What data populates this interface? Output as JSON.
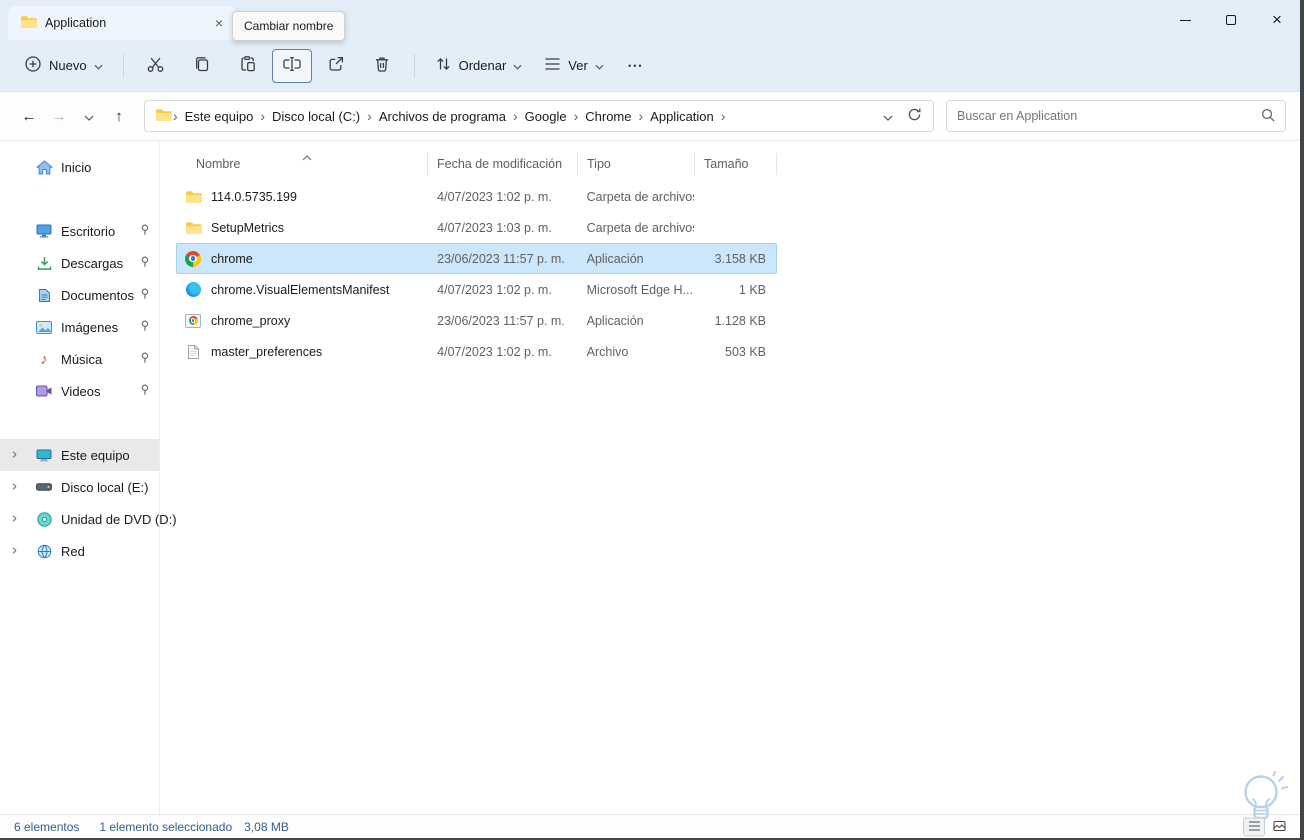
{
  "window": {
    "tab_title": "Application",
    "tooltip": "Cambiar nombre"
  },
  "icons": {
    "back": "←",
    "forward": "→",
    "up": "↑",
    "tab_close": "×",
    "window_close": "×",
    "more": "•••",
    "breadcrumb_separator": "›",
    "tree_chevron": "›",
    "music_note": "♪"
  },
  "toolbar": {
    "new_label": "Nuevo",
    "sort_label": "Ordenar",
    "view_label": "Ver"
  },
  "nav": {
    "search_placeholder": "Buscar en Application",
    "breadcrumbs": [
      "Este equipo",
      "Disco local (C:)",
      "Archivos de programa",
      "Google",
      "Chrome",
      "Application"
    ]
  },
  "sidebar": {
    "home": "Inicio",
    "pinned": [
      {
        "label": "Escritorio"
      },
      {
        "label": "Descargas"
      },
      {
        "label": "Documentos"
      },
      {
        "label": "Imágenes"
      },
      {
        "label": "Música"
      },
      {
        "label": "Videos"
      }
    ],
    "tree": [
      {
        "label": "Este equipo",
        "selected": true
      },
      {
        "label": "Disco local (E:)",
        "selected": false
      },
      {
        "label": "Unidad de DVD (D:)",
        "selected": false
      },
      {
        "label": "Red",
        "selected": false
      }
    ]
  },
  "file_list": {
    "columns": {
      "name": "Nombre",
      "date": "Fecha de modificación",
      "type": "Tipo",
      "size": "Tamaño"
    },
    "rows": [
      {
        "name": "114.0.5735.199",
        "date": "4/07/2023 1:02 p. m.",
        "type": "Carpeta de archivos",
        "size": "",
        "icon": "folder-icon",
        "selected": false
      },
      {
        "name": "SetupMetrics",
        "date": "4/07/2023 1:03 p. m.",
        "type": "Carpeta de archivos",
        "size": "",
        "icon": "folder-icon",
        "selected": false
      },
      {
        "name": "chrome",
        "date": "23/06/2023 11:57 p. m.",
        "type": "Aplicación",
        "size": "3.158 KB",
        "icon": "chrome-icon",
        "selected": true
      },
      {
        "name": "chrome.VisualElementsManifest",
        "date": "4/07/2023 1:02 p. m.",
        "type": "Microsoft Edge H...",
        "size": "1 KB",
        "icon": "edge-html-icon",
        "selected": false
      },
      {
        "name": "chrome_proxy",
        "date": "23/06/2023 11:57 p. m.",
        "type": "Aplicación",
        "size": "1.128 KB",
        "icon": "chrome-proxy-icon",
        "selected": false
      },
      {
        "name": "master_preferences",
        "date": "4/07/2023 1:02 p. m.",
        "type": "Archivo",
        "size": "503 KB",
        "icon": "file-icon",
        "selected": false
      }
    ]
  },
  "status_bar": {
    "total": "6 elementos",
    "selected": "1 elemento seleccionado",
    "size": "3,08 MB"
  },
  "colors": {
    "titlebar_bg": "#e3eef9",
    "selection_bg": "#cce6fb",
    "selection_border": "#a2d1f2",
    "sidebar_selected_bg": "#e9e9e9",
    "status_text": "#33608f",
    "folder_yellow": "#fbcb43"
  }
}
